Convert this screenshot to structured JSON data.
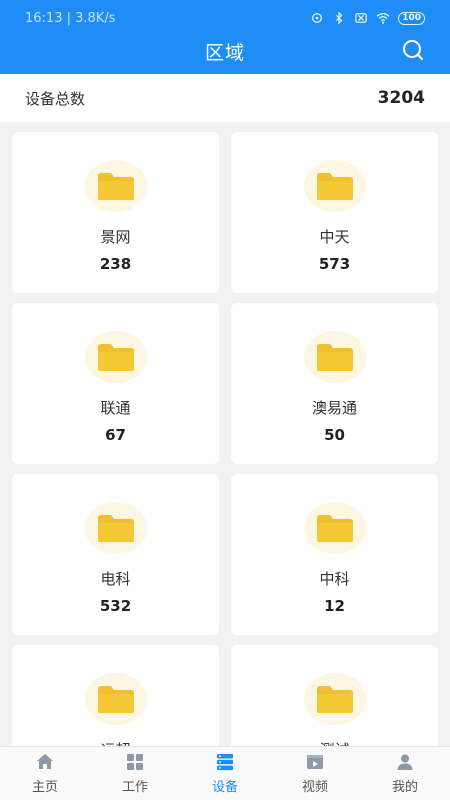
{
  "statusbar": {
    "time": "16:13",
    "speed": "3.8K/s",
    "battery": "100"
  },
  "header": {
    "title": "区域"
  },
  "summary": {
    "label": "设备总数",
    "value": "3204"
  },
  "areas": [
    {
      "name": "景网",
      "count": "238"
    },
    {
      "name": "中天",
      "count": "573"
    },
    {
      "name": "联通",
      "count": "67"
    },
    {
      "name": "澳易通",
      "count": "50"
    },
    {
      "name": "电科",
      "count": "532"
    },
    {
      "name": "中科",
      "count": "12"
    },
    {
      "name": "远超",
      "count": ""
    },
    {
      "name": "测试",
      "count": ""
    }
  ],
  "tabs": [
    {
      "label": "主页",
      "icon": "home-icon"
    },
    {
      "label": "工作",
      "icon": "grid-icon"
    },
    {
      "label": "设备",
      "icon": "server-icon",
      "active": true
    },
    {
      "label": "视频",
      "icon": "video-icon"
    },
    {
      "label": "我的",
      "icon": "user-icon"
    }
  ],
  "colors": {
    "primary": "#1e8df5",
    "folder": "#f0c02e",
    "folder_bg": "#fdf6e2",
    "tab_inactive": "#8e98a6"
  }
}
